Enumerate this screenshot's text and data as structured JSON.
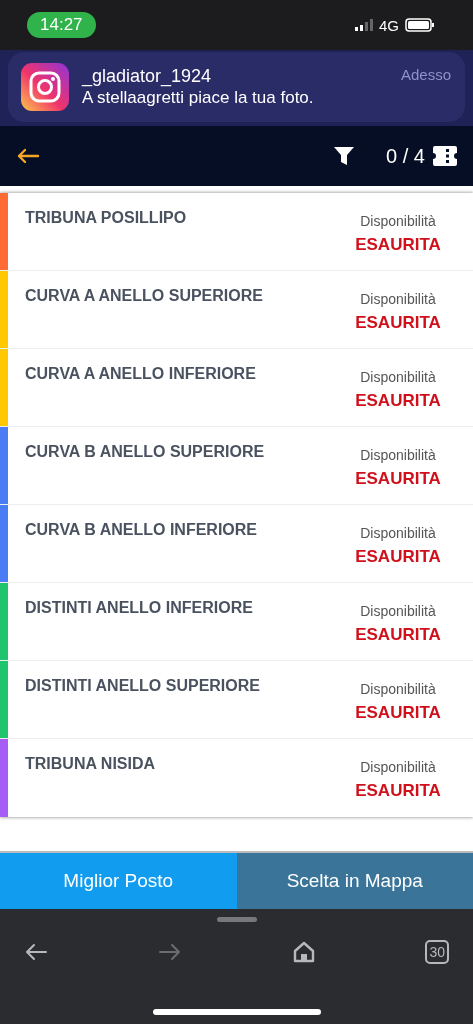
{
  "status_bar": {
    "time": "14:27",
    "network": "4G"
  },
  "notification": {
    "sender": "_gladiator_1924",
    "message": "A stellaagretti piace la tua foto.",
    "time": "Adesso"
  },
  "header": {
    "ticket_count": "0 / 4"
  },
  "sectors": [
    {
      "name": "TRIBUNA POSILLIPO",
      "availability_label": "Disponibilità",
      "availability": "ESAURITA",
      "color": "#ff6a35"
    },
    {
      "name": "CURVA A ANELLO SUPERIORE",
      "availability_label": "Disponibilità",
      "availability": "ESAURITA",
      "color": "#ffc800"
    },
    {
      "name": "CURVA A ANELLO INFERIORE",
      "availability_label": "Disponibilità",
      "availability": "ESAURITA",
      "color": "#ffc800"
    },
    {
      "name": "CURVA B ANELLO SUPERIORE",
      "availability_label": "Disponibilità",
      "availability": "ESAURITA",
      "color": "#4a7cf5"
    },
    {
      "name": "CURVA B ANELLO INFERIORE",
      "availability_label": "Disponibilità",
      "availability": "ESAURITA",
      "color": "#4a7cf5"
    },
    {
      "name": "DISTINTI ANELLO INFERIORE",
      "availability_label": "Disponibilità",
      "availability": "ESAURITA",
      "color": "#1fc46e"
    },
    {
      "name": "DISTINTI ANELLO SUPERIORE",
      "availability_label": "Disponibilità",
      "availability": "ESAURITA",
      "color": "#1fc46e"
    },
    {
      "name": "TRIBUNA NISIDA",
      "availability_label": "Disponibilità",
      "availability": "ESAURITA",
      "color": "#a65cf5"
    }
  ],
  "actions": [
    {
      "label": "Miglior Posto",
      "selected": true
    },
    {
      "label": "Scelta in Mappa",
      "selected": false
    }
  ],
  "browser_bar": {
    "back_disabled": false,
    "forward_disabled": true,
    "tab_count": "30"
  }
}
